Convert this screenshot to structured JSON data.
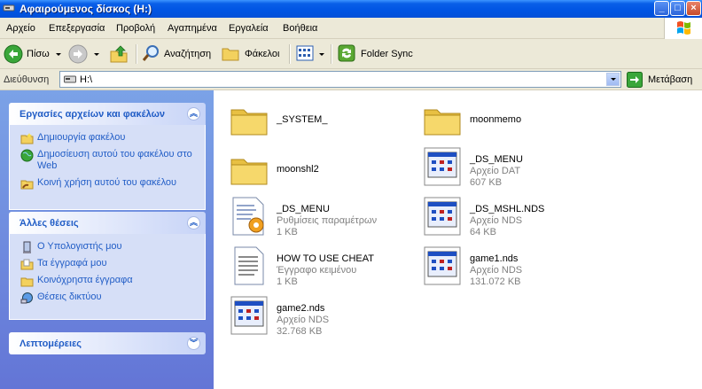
{
  "window": {
    "title": "Αφαιρούμενος δίσκος (H:)"
  },
  "menu": [
    "Αρχείο",
    "Επεξεργασία",
    "Προβολή",
    "Αγαπημένα",
    "Εργαλεία",
    "Βοήθεια"
  ],
  "toolbar": {
    "back_label": "Πίσω",
    "search_label": "Αναζήτηση",
    "folders_label": "Φάκελοι",
    "foldersync_label": "Folder Sync"
  },
  "address": {
    "label": "Διεύθυνση",
    "value": "H:\\",
    "go_label": "Μετάβαση"
  },
  "panels": [
    {
      "title": "Εργασίες αρχείων και φακέλων",
      "items": [
        {
          "label": "Δημιουργία φακέλου",
          "icon": "new-folder-icon"
        },
        {
          "label": "Δημοσίευση αυτού του φακέλου στο Web",
          "icon": "publish-web-icon"
        },
        {
          "label": "Κοινή χρήση αυτού του φακέλου",
          "icon": "share-folder-icon"
        }
      ]
    },
    {
      "title": "Άλλες θέσεις",
      "items": [
        {
          "label": "Ο Υπολογιστής μου",
          "icon": "my-computer-icon"
        },
        {
          "label": "Τα έγγραφά μου",
          "icon": "my-documents-icon"
        },
        {
          "label": "Κοινόχρηστα έγγραφα",
          "icon": "shared-documents-icon"
        },
        {
          "label": "Θέσεις δικτύου",
          "icon": "network-places-icon"
        }
      ]
    },
    {
      "title": "Λεπτομέρειες",
      "items": []
    }
  ],
  "files": [
    {
      "name": "_SYSTEM_",
      "kind": "folder"
    },
    {
      "name": "moonmemo",
      "kind": "folder"
    },
    {
      "name": "moonshl2",
      "kind": "folder"
    },
    {
      "name": "_DS_MENU",
      "type": "Αρχείο DAT",
      "size": "607 KB",
      "kind": "app"
    },
    {
      "name": "_DS_MENU",
      "type": "Ρυθμίσεις παραμέτρων",
      "size": "1 KB",
      "kind": "config"
    },
    {
      "name": "_DS_MSHL.NDS",
      "type": "Αρχείο NDS",
      "size": "64 KB",
      "kind": "app"
    },
    {
      "name": "HOW TO USE CHEAT",
      "type": "Έγγραφο κειμένου",
      "size": "1 KB",
      "kind": "text"
    },
    {
      "name": "game1.nds",
      "type": "Αρχείο NDS",
      "size": "131.072 KB",
      "kind": "app"
    },
    {
      "name": "game2.nds",
      "type": "Αρχείο NDS",
      "size": "32.768 KB",
      "kind": "app"
    }
  ]
}
